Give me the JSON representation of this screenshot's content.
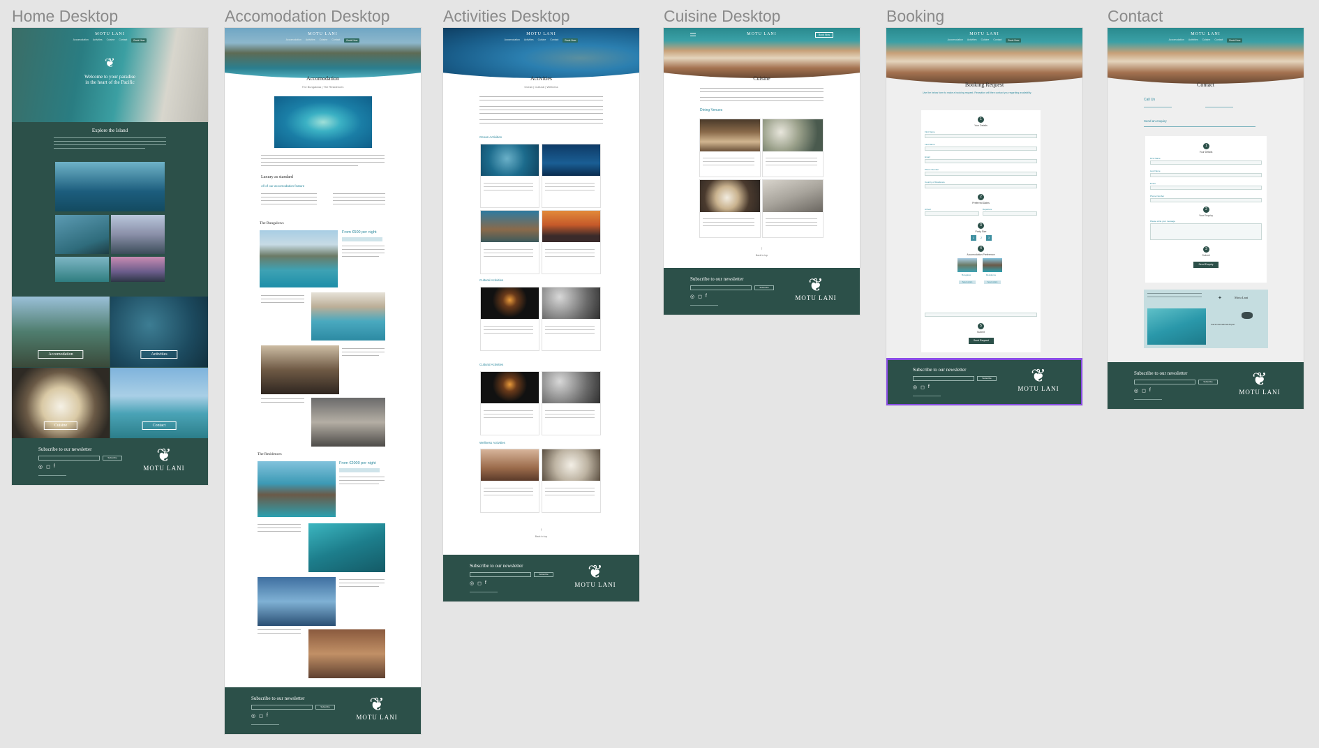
{
  "frames": {
    "home": "Home Desktop",
    "accommodation": "Accomodation Desktop",
    "activities": "Activities Desktop",
    "cuisine": "Cuisine Desktop",
    "booking": "Booking",
    "contact": "Contact"
  },
  "brand": {
    "logo": "MOTU LANI",
    "footer_brand": "MOTU LANI",
    "colors": {
      "primary": "#2c5049",
      "accent": "#2e8a9e",
      "highlight": "#8a4de6"
    }
  },
  "nav": {
    "items": [
      "Accomodation",
      "Activities",
      "Cuisine",
      "Contact"
    ],
    "book": "Book Now"
  },
  "home": {
    "hero_title": "Welcome to your paradise",
    "hero_title2": "in the heart of the Pacific",
    "explore": "Explore the Island",
    "tiles": [
      "Accomodation",
      "Activities",
      "Cuisine",
      "Contact"
    ]
  },
  "accommodation": {
    "title": "Accomodation",
    "breadcrumb": "The Bungalows | The Residences",
    "luxury": "Luxury as standard",
    "features_title": "All of our accomodation feature",
    "bungalows": "The Bungalows",
    "bungalows_price": "From €500 per night",
    "residences": "The Residences",
    "residences_price": "From €2000 per night"
  },
  "activities": {
    "title": "Activities",
    "tabs": "Ocean | Cultural | Wellness",
    "sections": [
      "Ocean Activities",
      "Cultural Activities",
      "Cultural Activities",
      "Wellness Activities"
    ],
    "back": "Back to top"
  },
  "cuisine": {
    "title": "Cuisine",
    "venues": "Dining Venues",
    "back": "Back to top"
  },
  "booking": {
    "title": "Booking Request",
    "intro": "Use the below form to make a booking request. Reception will then contact you regarding availability.",
    "steps": [
      "Your Details",
      "Preferred Dates",
      "Party Size",
      "Accomodation Preference",
      "Submit"
    ],
    "fields": [
      "First Name",
      "Last Name",
      "Email",
      "Phone Number",
      "Country of Residence",
      "Arrival",
      "Departure"
    ],
    "party": [
      "1",
      "2",
      "3"
    ],
    "options": [
      "Bungalow",
      "Residence"
    ],
    "select_label": "Select option",
    "submit": "Send Request"
  },
  "contact": {
    "title": "Contact",
    "call": "Call Us",
    "send": "Send an enquiry",
    "steps": [
      "Your Details",
      "Your Enquiry",
      "Submit"
    ],
    "fields": [
      "First Name",
      "Last Name",
      "Email",
      "Phone Number",
      "Please write your message"
    ],
    "submit": "Send Enquiry",
    "map_brand": "Motu Lani",
    "airport": "Fua'a International Airport"
  },
  "footer": {
    "subscribe": "Subscribe to our newsletter",
    "button": "Subscribe",
    "social_icons": [
      "tripadvisor-icon",
      "instagram-icon",
      "facebook-icon"
    ]
  }
}
